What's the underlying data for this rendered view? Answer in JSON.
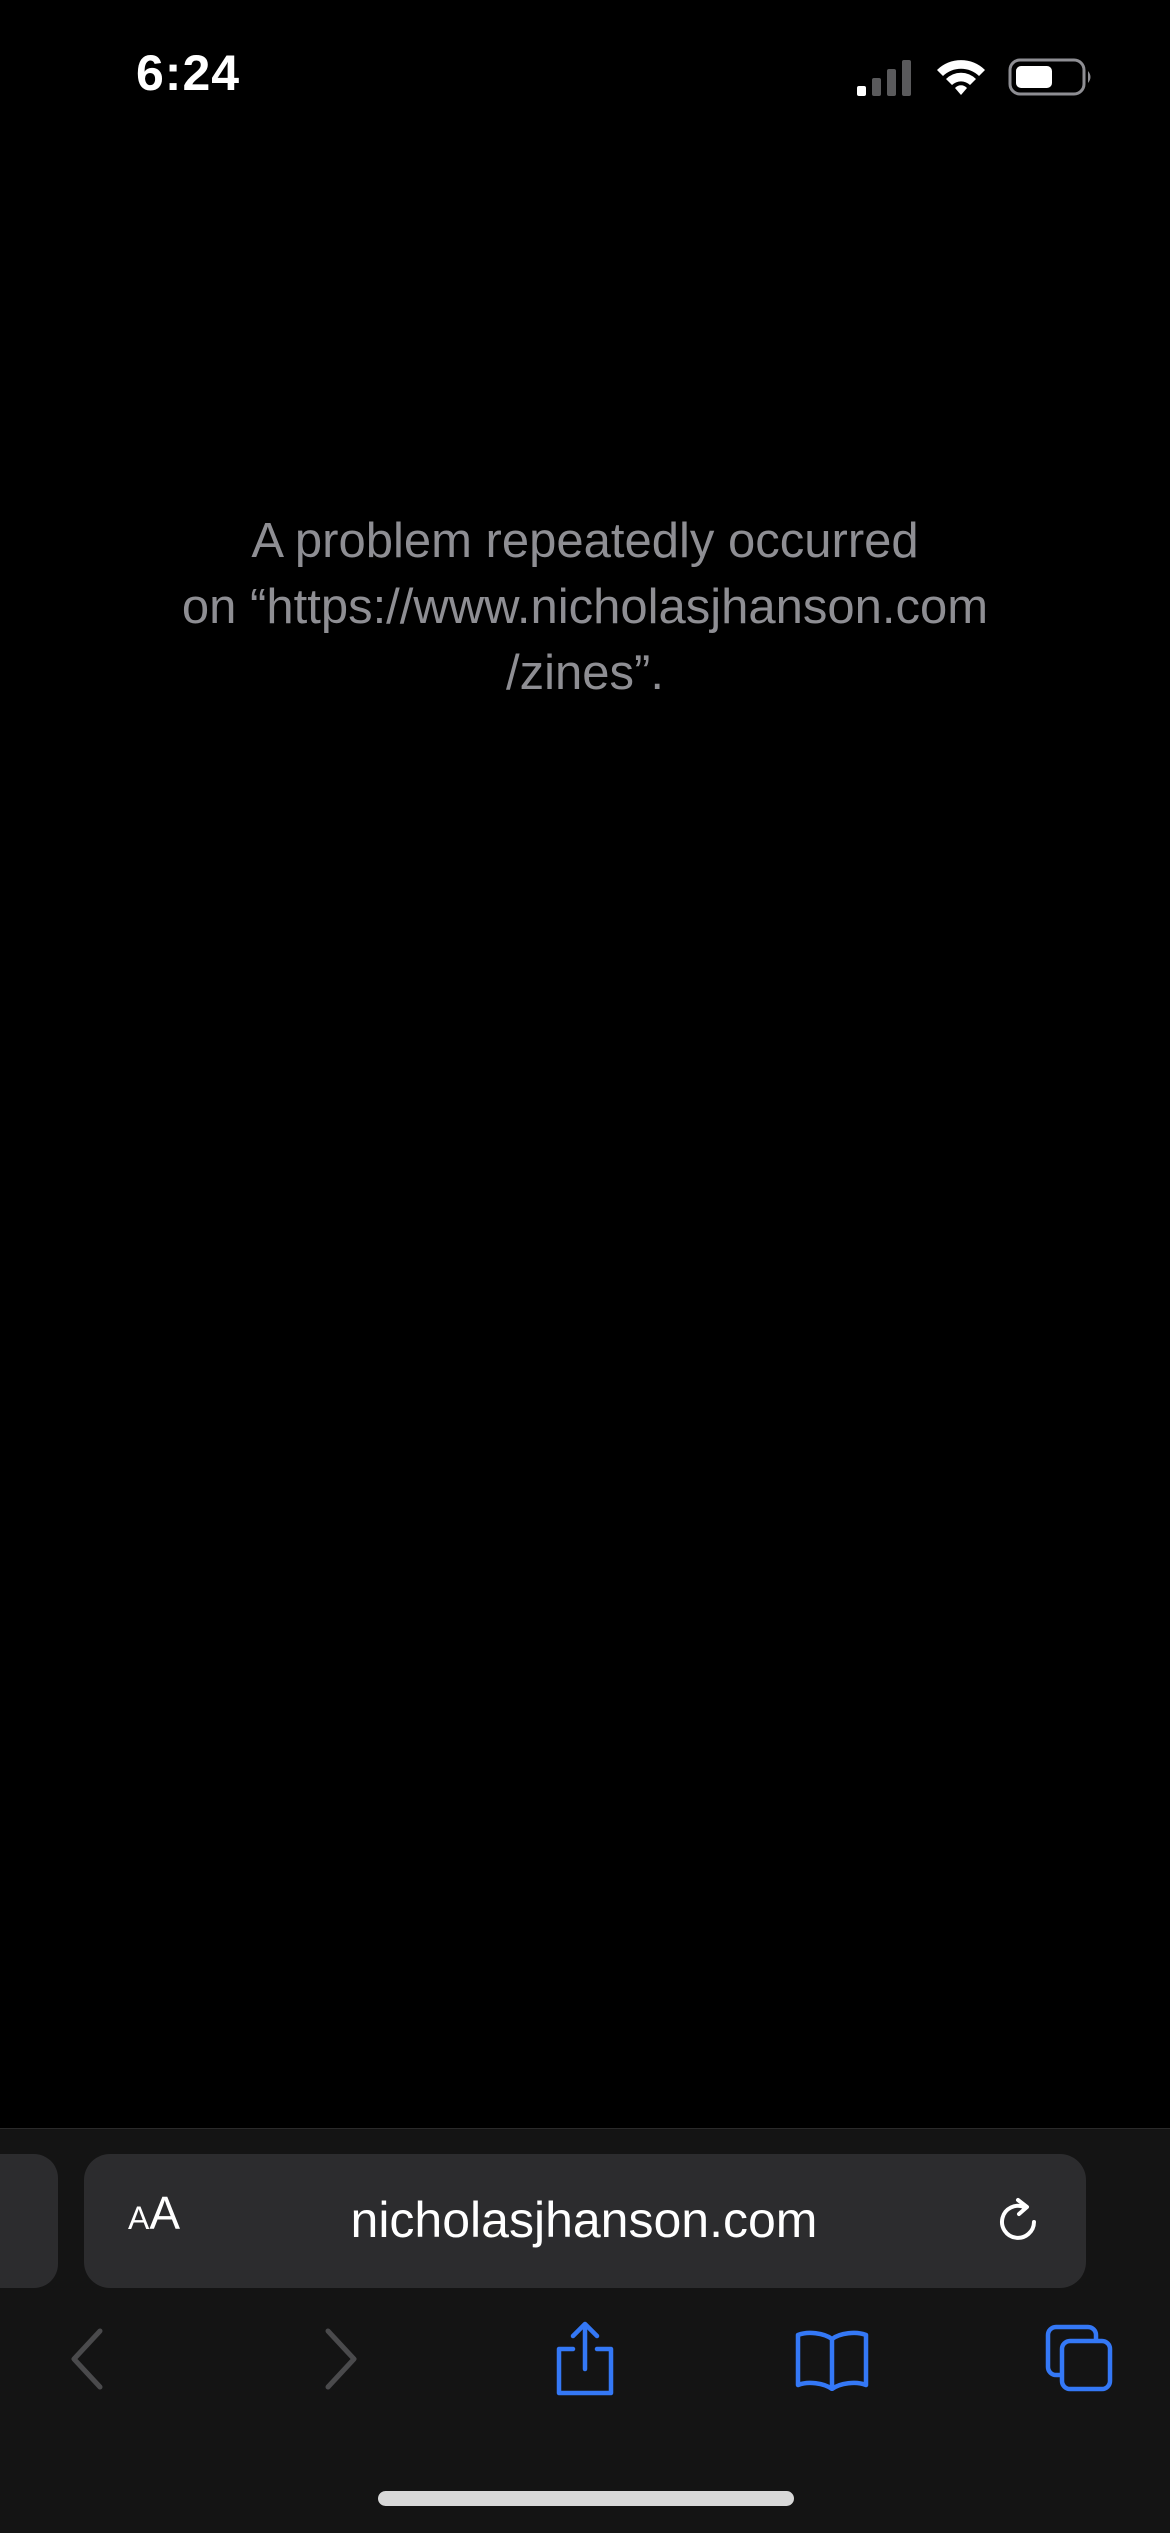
{
  "status_bar": {
    "time": "6:24",
    "signal_icon": "cellular-signal-icon",
    "wifi_icon": "wifi-icon",
    "battery_icon": "battery-icon"
  },
  "page": {
    "error_lines": [
      "A problem repeatedly occurred",
      "on “https://www.nicholasjhanson.com",
      "/zines”."
    ]
  },
  "address_bar": {
    "reader_small": "A",
    "reader_big": "A",
    "url": "nicholasjhanson.com",
    "reload_icon": "reload-icon"
  },
  "toolbar": {
    "back_icon": "chevron-left-icon",
    "forward_icon": "chevron-right-icon",
    "share_icon": "share-icon",
    "bookmarks_icon": "book-icon",
    "tabs_icon": "tabs-icon"
  },
  "colors": {
    "background": "#000000",
    "message_text": "#8e8e93",
    "toolbar_bg": "#141414",
    "address_bg": "#2c2c2e",
    "accent": "#3478f6",
    "disabled": "#4a4a4c"
  }
}
